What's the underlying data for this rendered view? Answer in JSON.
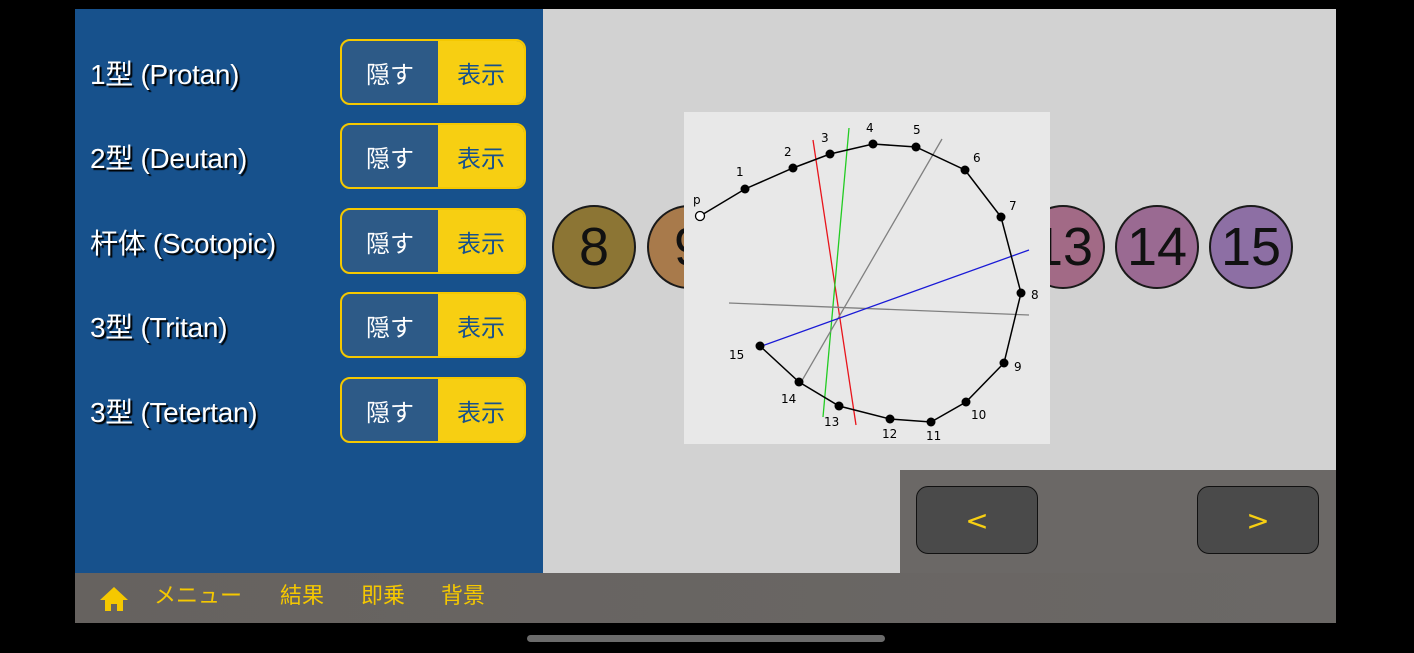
{
  "filters": [
    {
      "label": "1型 (Protan)",
      "hide": "隠す",
      "show": "表示"
    },
    {
      "label": "2型 (Deutan)",
      "hide": "隠す",
      "show": "表示"
    },
    {
      "label": "杆体 (Scotopic)",
      "hide": "隠す",
      "show": "表示"
    },
    {
      "label": "3型 (Tritan)",
      "hide": "隠す",
      "show": "表示"
    },
    {
      "label": "3型 (Tetertan)",
      "hide": "隠す",
      "show": "表示"
    }
  ],
  "caps": [
    {
      "label": "8",
      "color": "#8c7534"
    },
    {
      "label": "9",
      "color": "#a87a4b"
    },
    {
      "label": "13",
      "color": "#a26a86"
    },
    {
      "label": "14",
      "color": "#9a6a92"
    },
    {
      "label": "15",
      "color": "#8d6fa4"
    }
  ],
  "plot": {
    "start_label": "p",
    "points": [
      {
        "n": "1"
      },
      {
        "n": "2"
      },
      {
        "n": "3"
      },
      {
        "n": "4"
      },
      {
        "n": "5"
      },
      {
        "n": "6"
      },
      {
        "n": "7"
      },
      {
        "n": "8"
      },
      {
        "n": "9"
      },
      {
        "n": "10"
      },
      {
        "n": "11"
      },
      {
        "n": "12"
      },
      {
        "n": "13"
      },
      {
        "n": "14"
      },
      {
        "n": "15"
      }
    ],
    "axis_colors": {
      "protan": "#e8141b",
      "deutan": "#22cc22",
      "tritan": "#1a1ad6",
      "scotopic": "#808080",
      "tetartan": "#808080"
    }
  },
  "nav": {
    "prev": "<",
    "next": ">"
  },
  "bottom": {
    "menu": "メニュー",
    "results": "結果",
    "multiply": "即乗",
    "background": "背景"
  },
  "colors": {
    "accent": "#f7cf12",
    "sidebar": "#17518c"
  }
}
